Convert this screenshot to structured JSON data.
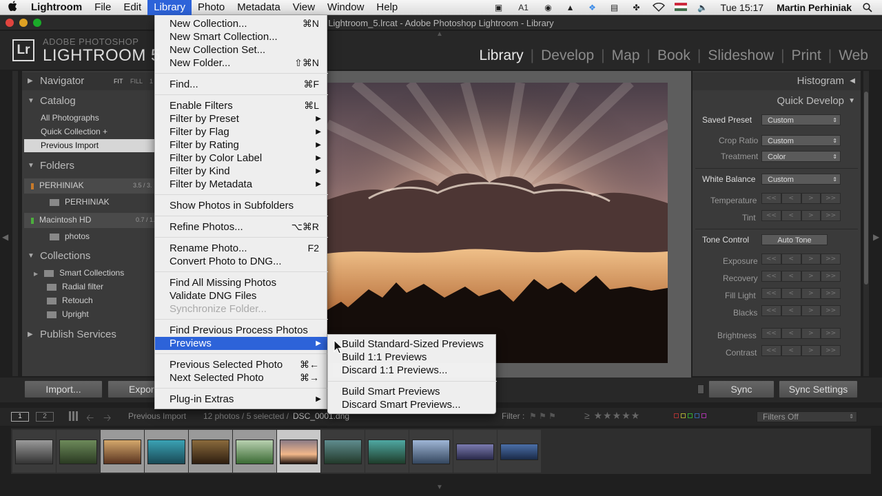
{
  "menubar": {
    "app": "Lightroom",
    "items": [
      "File",
      "Edit",
      "Library",
      "Photo",
      "Metadata",
      "View",
      "Window",
      "Help"
    ],
    "clock": "Tue 15:17",
    "user": "Martin Perhiniak",
    "adobe_badge": "1"
  },
  "window": {
    "title": "Lightroom_5.lrcat - Adobe Photoshop Lightroom - Library"
  },
  "header": {
    "brand_small": "ADOBE PHOTOSHOP",
    "brand_big": "LIGHTROOM 5",
    "logo": "Lr",
    "modules": [
      "Library",
      "Develop",
      "Map",
      "Book",
      "Slideshow",
      "Print",
      "Web"
    ]
  },
  "left_panel": {
    "navigator": "Navigator",
    "nav_modes": [
      "FIT",
      "FILL",
      "1"
    ],
    "catalog": "Catalog",
    "catalog_items": [
      "All Photographs",
      "Quick Collection +",
      "Previous Import"
    ],
    "folders": "Folders",
    "volumes": [
      {
        "name": "PERHINIAK",
        "size": "3.5 / 3.",
        "sub": "PERHINIAK"
      },
      {
        "name": "Macintosh HD",
        "size": "0.7 / 1.",
        "sub": "photos"
      }
    ],
    "collections": "Collections",
    "collection_items": [
      "Smart Collections",
      "Radial filter",
      "Retouch",
      "Upright"
    ],
    "publish": "Publish Services"
  },
  "right_panel": {
    "histogram": "Histogram",
    "quick_develop": "Quick Develop",
    "saved_preset_label": "Saved Preset",
    "saved_preset_value": "Custom",
    "crop_label": "Crop Ratio",
    "crop_value": "Custom",
    "treatment_label": "Treatment",
    "treatment_value": "Color",
    "wb_label": "White Balance",
    "wb_value": "Custom",
    "temperature": "Temperature",
    "tint": "Tint",
    "tone_label": "Tone Control",
    "auto_tone": "Auto Tone",
    "tone_rows": [
      "Exposure",
      "Recovery",
      "Fill Light",
      "Blacks",
      "Brightness",
      "Contrast"
    ],
    "step_glyphs": [
      "<<",
      "<",
      ">",
      ">>"
    ]
  },
  "toolbar": {
    "import": "Import...",
    "export": "Export...",
    "sync": "Sync",
    "sync_settings": "Sync Settings"
  },
  "filmstrip_bar": {
    "pages": [
      "1",
      "2"
    ],
    "source": "Previous Import",
    "count": "12 photos / 5 selected /",
    "file": "DSC_0001.dng",
    "filter_label": "Filter :",
    "stars_glyph": "≥ ★★★★★",
    "filters_off": "Filters Off"
  },
  "library_menu": {
    "items": [
      {
        "label": "New Collection...",
        "shortcut": "⌘N"
      },
      {
        "label": "New Smart Collection...",
        "shortcut": ""
      },
      {
        "label": "New Collection Set...",
        "shortcut": ""
      },
      {
        "label": "New Folder...",
        "shortcut": "⇧⌘N"
      },
      {
        "label": "Find...",
        "shortcut": "⌘F"
      },
      {
        "label": "Enable Filters",
        "shortcut": "⌘L"
      },
      {
        "label": "Filter by Preset",
        "shortcut": ""
      },
      {
        "label": "Filter by Flag",
        "shortcut": ""
      },
      {
        "label": "Filter by Rating",
        "shortcut": ""
      },
      {
        "label": "Filter by Color Label",
        "shortcut": ""
      },
      {
        "label": "Filter by Kind",
        "shortcut": ""
      },
      {
        "label": "Filter by Metadata",
        "shortcut": ""
      },
      {
        "label": "Show Photos in Subfolders",
        "shortcut": ""
      },
      {
        "label": "Refine Photos...",
        "shortcut": "⌥⌘R"
      },
      {
        "label": "Rename Photo...",
        "shortcut": "F2"
      },
      {
        "label": "Convert Photo to DNG...",
        "shortcut": ""
      },
      {
        "label": "Find All Missing Photos",
        "shortcut": ""
      },
      {
        "label": "Validate DNG Files",
        "shortcut": ""
      },
      {
        "label": "Synchronize Folder...",
        "shortcut": ""
      },
      {
        "label": "Find Previous Process Photos",
        "shortcut": ""
      },
      {
        "label": "Previews",
        "shortcut": ""
      },
      {
        "label": "Previous Selected Photo",
        "shortcut": "⌘←"
      },
      {
        "label": "Next Selected Photo",
        "shortcut": "⌘→"
      },
      {
        "label": "Plug-in Extras",
        "shortcut": ""
      }
    ],
    "submenu_arrow": "▶"
  },
  "previews_submenu": {
    "items": [
      "Build Standard-Sized Previews",
      "Build 1:1 Previews",
      "Discard 1:1 Previews...",
      "Build Smart Previews",
      "Discard Smart Previews..."
    ]
  },
  "colors": {
    "menu_highlight": "#2d63d9",
    "panel_bg": "#3a3a3a",
    "app_bg": "#1f1f1f"
  }
}
